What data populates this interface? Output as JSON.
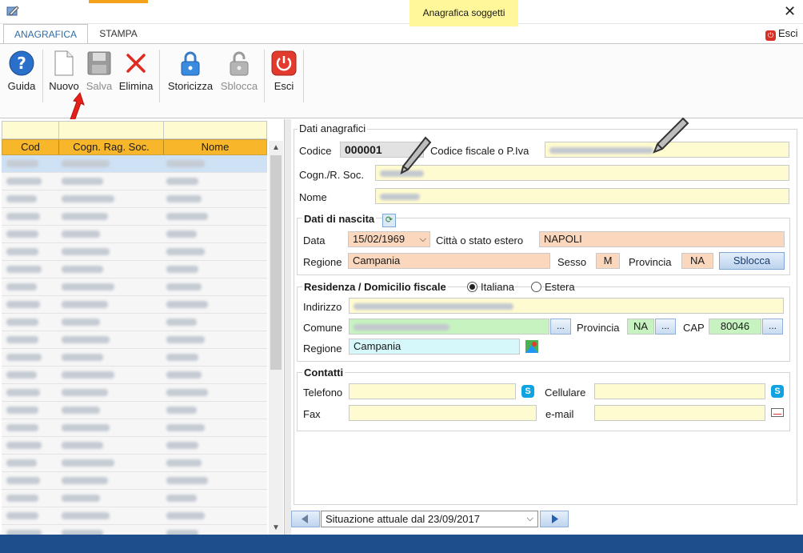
{
  "window": {
    "title": "Anagrafica soggetti"
  },
  "tabs": [
    {
      "label": "ANAGRAFICA",
      "active": true
    },
    {
      "label": "STAMPA",
      "active": false
    }
  ],
  "exit_top": "Esci",
  "ribbon": {
    "guida": "Guida",
    "nuovo": "Nuovo",
    "salva": "Salva",
    "elimina": "Elimina",
    "storicizza": "Storicizza",
    "sblocca": "Sblocca",
    "esci": "Esci"
  },
  "grid": {
    "columns": [
      "Cod",
      "Cogn. Rag. Soc.",
      "Nome"
    ]
  },
  "form": {
    "dati_anagrafici": {
      "legend": "Dati anagrafici",
      "codice_label": "Codice",
      "codice_value": "000001",
      "cf_label": "Codice fiscale o P.Iva",
      "cognome_label": "Cogn./R. Soc.",
      "nome_label": "Nome"
    },
    "dati_nascita": {
      "legend": "Dati di nascita",
      "data_label": "Data",
      "data_value": "15/02/1969",
      "citta_label": "Città o stato estero",
      "citta_value": "NAPOLI",
      "regione_label": "Regione",
      "regione_value": "Campania",
      "sesso_label": "Sesso",
      "sesso_value": "M",
      "provincia_label": "Provincia",
      "provincia_value": "NA",
      "sblocca_button": "Sblocca"
    },
    "residenza": {
      "legend": "Residenza / Domicilio fiscale",
      "radio_italiana": "Italiana",
      "radio_estera": "Estera",
      "indirizzo_label": "Indirizzo",
      "comune_label": "Comune",
      "dots": "...",
      "provincia_label": "Provincia",
      "provincia_value": "NA",
      "cap_label": "CAP",
      "cap_value": "80046",
      "regione_label": "Regione",
      "regione_value": "Campania"
    },
    "contatti": {
      "legend": "Contatti",
      "telefono_label": "Telefono",
      "cellulare_label": "Cellulare",
      "fax_label": "Fax",
      "email_label": "e-mail"
    }
  },
  "history_nav": {
    "selected": "Situazione attuale dal 23/09/2017"
  },
  "colors": {
    "accent_tab": "#2d6da8",
    "grid_header": "#f8b72a",
    "input_yellow": "#fffbd1",
    "input_peach": "#fbd8bd",
    "input_green": "#c6f3c0",
    "statusbar": "#1e4e8c",
    "title_highlight": "#fff799"
  }
}
